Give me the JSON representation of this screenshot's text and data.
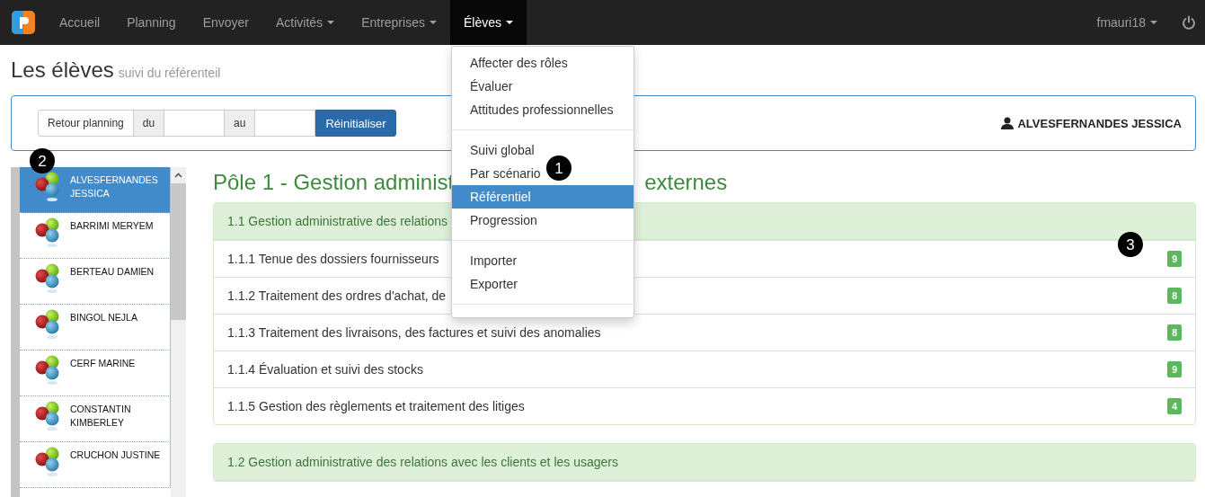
{
  "navbar": {
    "items": [
      {
        "label": "Accueil",
        "dropdown": false,
        "selected": false
      },
      {
        "label": "Planning",
        "dropdown": false,
        "selected": false
      },
      {
        "label": "Envoyer",
        "dropdown": false,
        "selected": false
      },
      {
        "label": "Activités",
        "dropdown": true,
        "selected": false
      },
      {
        "label": "Entreprises",
        "dropdown": true,
        "selected": false
      },
      {
        "label": "Élèves",
        "dropdown": true,
        "selected": true
      }
    ],
    "user": "fmauri18"
  },
  "header": {
    "title": "Les élèves",
    "subtitle": "suivi du référenteil"
  },
  "filter": {
    "back_button": "Retour planning",
    "from_label": "du",
    "to_label": "au",
    "reset_button": "Réinitialiser",
    "student": "ALVESFERNANDES JESSICA"
  },
  "students": [
    {
      "name": "ALVESFERNANDES JESSICA",
      "selected": true,
      "callout": "2"
    },
    {
      "name": "BARRIMI MERYEM",
      "selected": false
    },
    {
      "name": "BERTEAU DAMIEN",
      "selected": false
    },
    {
      "name": "BINGOL NEJLA",
      "selected": false
    },
    {
      "name": "CERF MARINE",
      "selected": false
    },
    {
      "name": "CONSTANTIN KIMBERLEY",
      "selected": false
    },
    {
      "name": "CRUCHON JUSTINE",
      "selected": false
    }
  ],
  "pole": {
    "title_parts": [
      "Pôle 1 - Gestion administ",
      "externes"
    ],
    "sections": [
      {
        "title": "1.1 Gestion administrative des relations",
        "rows": [
          {
            "label": "1.1.1 Tenue des dossiers fournisseurs",
            "count": "9",
            "callout": "3"
          },
          {
            "label": "1.1.2 Traitement des ordres d'achat, de",
            "count": "8"
          },
          {
            "label": "1.1.3 Traitement des livraisons, des factures et suivi des anomalies",
            "count": "8"
          },
          {
            "label": "1.1.4 Évaluation et suivi des stocks",
            "count": "9"
          },
          {
            "label": "1.1.5 Gestion des règlements et traitement des litiges",
            "count": "4"
          }
        ]
      },
      {
        "title": "1.2 Gestion administrative des relations avec les clients et les usagers"
      }
    ]
  },
  "menu": {
    "groups": [
      [
        {
          "label": "Affecter des rôles",
          "selected": false
        },
        {
          "label": "Évaluer",
          "selected": false
        },
        {
          "label": "Attitudes professionnelles",
          "selected": false
        }
      ],
      [
        {
          "label": "Suivi global",
          "selected": false
        },
        {
          "label": "Par scénario",
          "selected": false,
          "callout": "1"
        },
        {
          "label": "Référentiel",
          "selected": true
        },
        {
          "label": "Progression",
          "selected": false
        }
      ],
      [
        {
          "label": "Importer",
          "selected": false
        },
        {
          "label": "Exporter",
          "selected": false
        }
      ]
    ]
  }
}
